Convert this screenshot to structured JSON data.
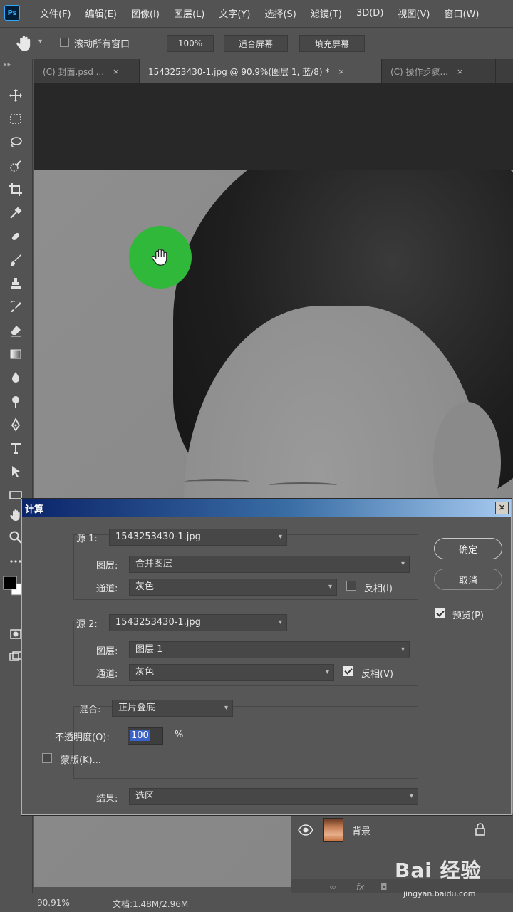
{
  "app": {
    "logo": "Ps"
  },
  "menu": [
    "文件(F)",
    "编辑(E)",
    "图像(I)",
    "图层(L)",
    "文字(Y)",
    "选择(S)",
    "滤镜(T)",
    "3D(D)",
    "视图(V)",
    "窗口(W)"
  ],
  "options": {
    "scroll_all_label": "滚动所有窗口",
    "zoom_value": "100%",
    "fit_screen_label": "适合屏幕",
    "fill_screen_label": "填充屏幕"
  },
  "tabs": [
    {
      "label": "(C) 封面.psd ...",
      "close": "×"
    },
    {
      "label": "1543253430-1.jpg @ 90.9%(图层 1, 蓝/8) *",
      "close": "×"
    },
    {
      "label": "(C) 操作步骤...",
      "close": "×"
    }
  ],
  "dialog": {
    "title": "计算",
    "close": "×",
    "source1": {
      "label": "源 1:",
      "file": "1543253430-1.jpg",
      "layer_label": "图层:",
      "layer": "合并图层",
      "channel_label": "通道:",
      "channel": "灰色",
      "invert_label": "反相(I)",
      "invert_checked": false
    },
    "source2": {
      "label": "源 2:",
      "file": "1543253430-1.jpg",
      "layer_label": "图层:",
      "layer": "图层 1",
      "channel_label": "通道:",
      "channel": "灰色",
      "invert_label": "反相(V)",
      "invert_checked": true
    },
    "blend": {
      "label": "混合:",
      "mode": "正片叠底",
      "opacity_label": "不透明度(O):",
      "opacity_value": "100",
      "opacity_unit": "%",
      "mask_label": "蒙版(K)...",
      "mask_checked": false
    },
    "result": {
      "label": "结果:",
      "value": "选区"
    },
    "ok_label": "确定",
    "cancel_label": "取消",
    "preview_label": "预览(P)",
    "preview_checked": true
  },
  "layers": {
    "name": "背景"
  },
  "status": {
    "zoom": "90.91%",
    "doc": "文档:1.48M/2.96M"
  },
  "watermark": {
    "logo": "Bai 经验",
    "url": "jingyan.baidu.com"
  },
  "colors": {
    "hand_indicator": "#2fb83a",
    "dialog_title_start": "#0b246a",
    "dialog_title_end": "#a6caf0"
  },
  "icons": [
    "move-icon",
    "marquee-icon",
    "lasso-icon",
    "quick-select-icon",
    "crop-icon",
    "eyedropper-icon",
    "healing-brush-icon",
    "brush-icon",
    "stamp-icon",
    "history-brush-icon",
    "eraser-icon",
    "gradient-icon",
    "blur-icon",
    "dodge-icon",
    "pen-icon",
    "type-icon",
    "path-select-icon",
    "rectangle-icon",
    "hand-icon",
    "zoom-icon"
  ]
}
